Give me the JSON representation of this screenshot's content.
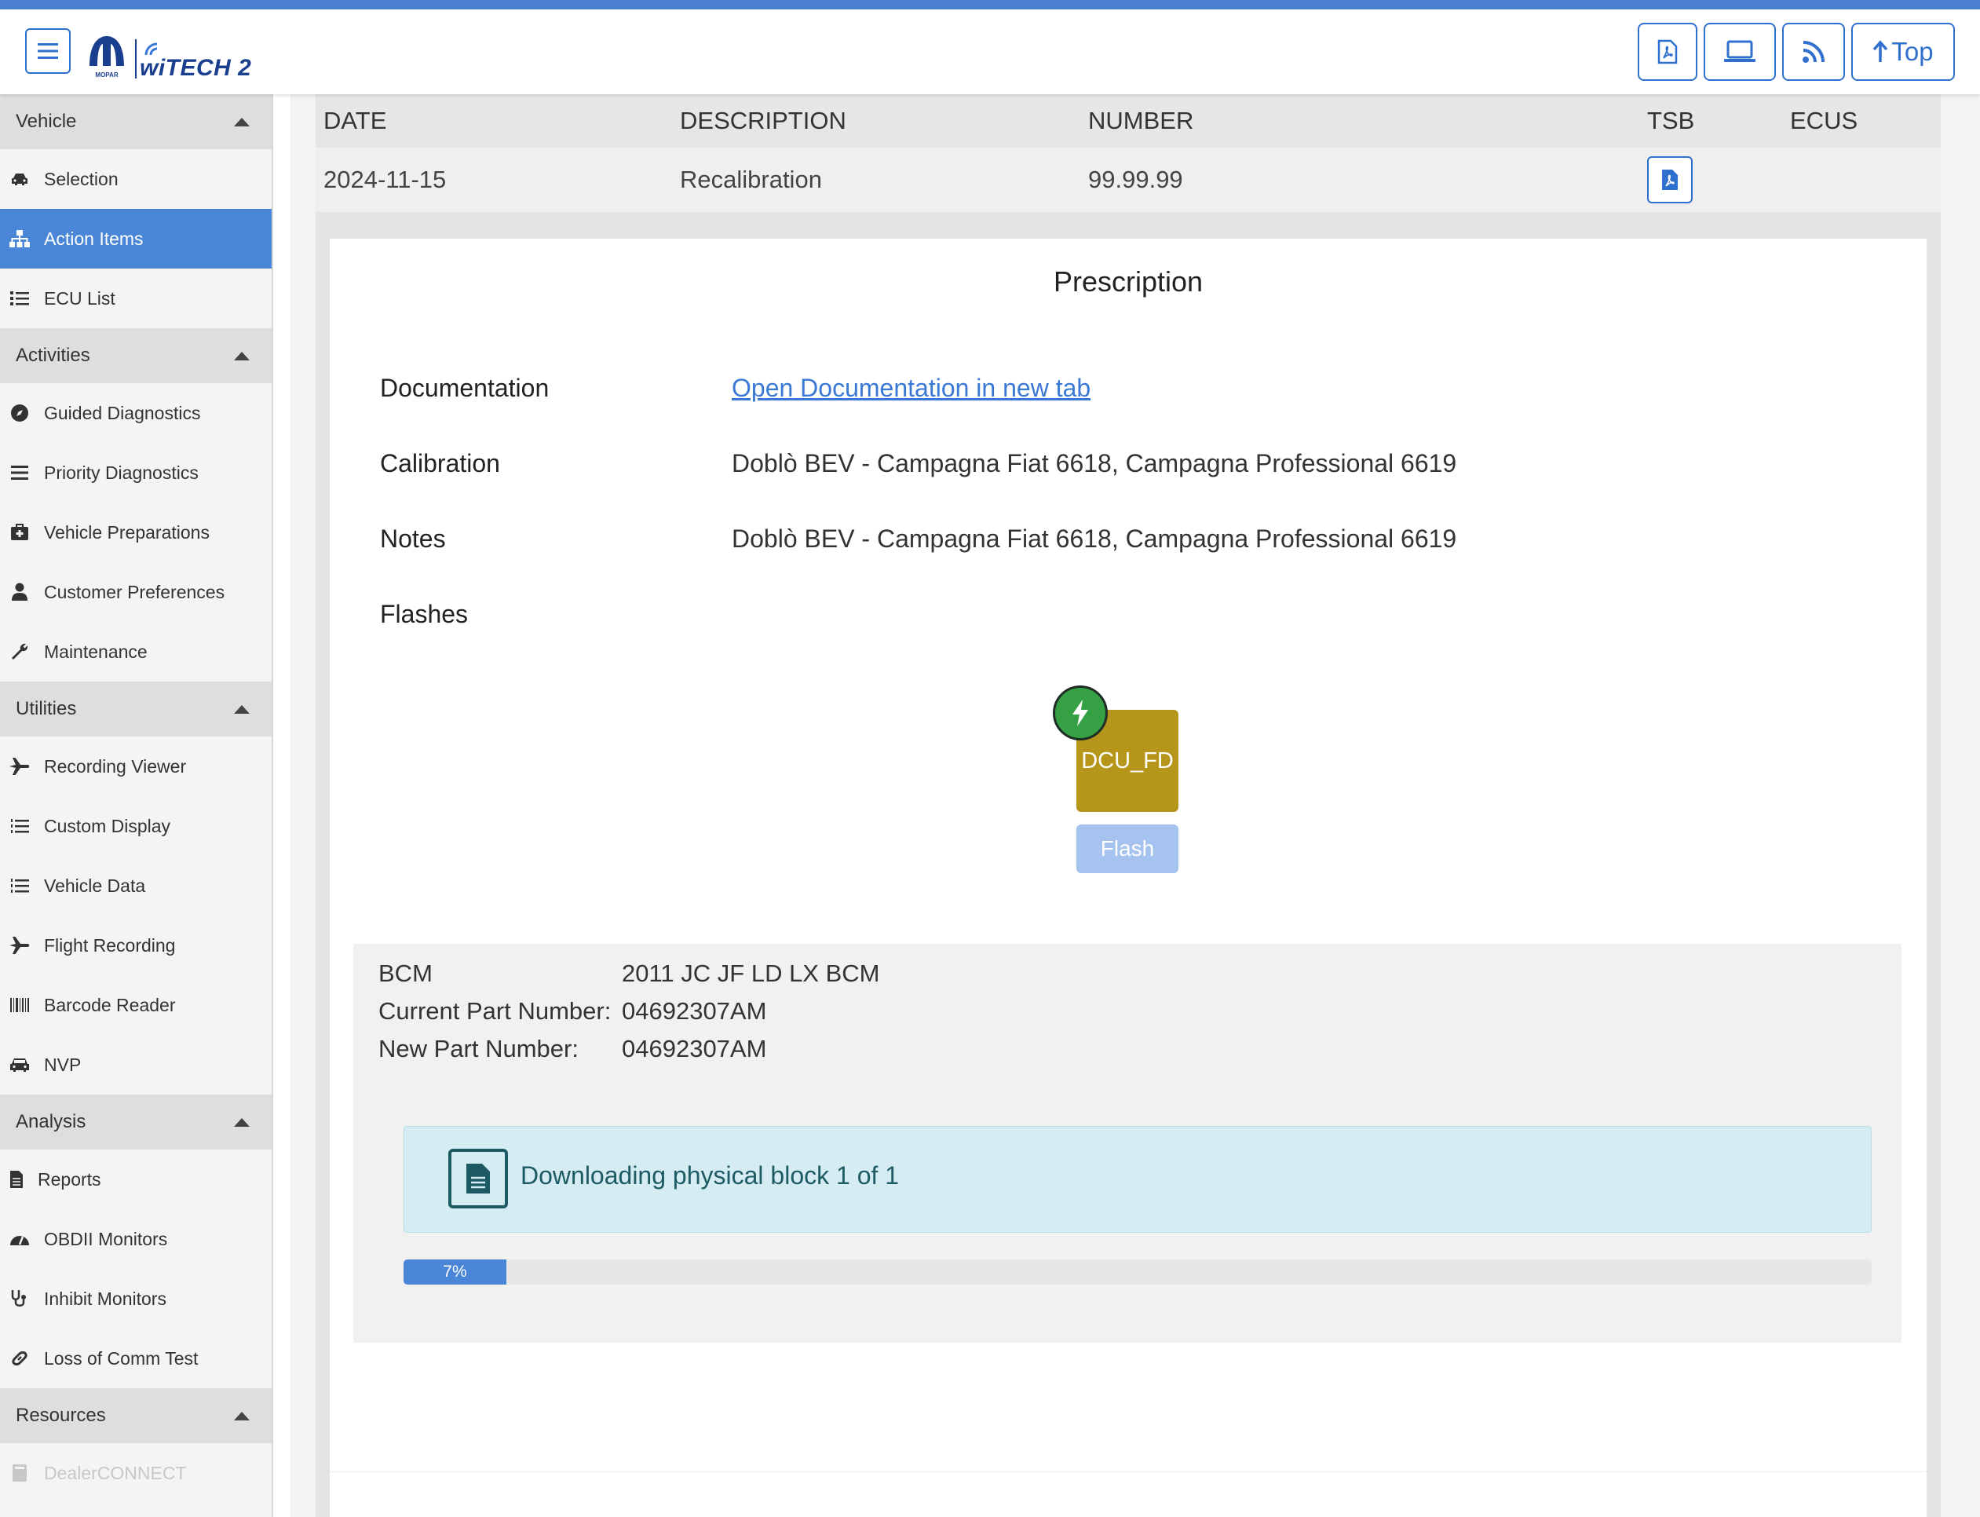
{
  "header": {
    "brand_mopar": "MOPAR",
    "brand_witech": "wiTECH 2",
    "top_button_label": "Top",
    "icons": [
      "menu-icon",
      "pdf-icon",
      "laptop-icon",
      "rss-icon",
      "arrow-up-icon"
    ]
  },
  "sidebar": {
    "sections": [
      {
        "title": "Vehicle",
        "items": [
          {
            "label": "Selection",
            "icon": "car-icon"
          },
          {
            "label": "Action Items",
            "icon": "sitemap-icon",
            "active": true
          },
          {
            "label": "ECU List",
            "icon": "list-icon"
          }
        ]
      },
      {
        "title": "Activities",
        "items": [
          {
            "label": "Guided Diagnostics",
            "icon": "compass-icon"
          },
          {
            "label": "Priority Diagnostics",
            "icon": "priority-icon"
          },
          {
            "label": "Vehicle Preparations",
            "icon": "medkit-icon"
          },
          {
            "label": "Customer Preferences",
            "icon": "user-icon"
          },
          {
            "label": "Maintenance",
            "icon": "wrench-icon"
          }
        ]
      },
      {
        "title": "Utilities",
        "items": [
          {
            "label": "Recording Viewer",
            "icon": "plane-icon"
          },
          {
            "label": "Custom Display",
            "icon": "list-ol-icon"
          },
          {
            "label": "Vehicle Data",
            "icon": "list-ol-icon"
          },
          {
            "label": "Flight Recording",
            "icon": "plane-icon"
          },
          {
            "label": "Barcode Reader",
            "icon": "barcode-icon"
          },
          {
            "label": "NVP",
            "icon": "car-front-icon"
          }
        ]
      },
      {
        "title": "Analysis",
        "items": [
          {
            "label": "Reports",
            "icon": "file-icon"
          },
          {
            "label": "OBDII Monitors",
            "icon": "gauge-icon"
          },
          {
            "label": "Inhibit Monitors",
            "icon": "stethoscope-icon"
          },
          {
            "label": "Loss of Comm Test",
            "icon": "link-icon"
          }
        ]
      },
      {
        "title": "Resources",
        "items": [
          {
            "label": "DealerCONNECT",
            "icon": "book-icon",
            "disabled": true
          }
        ]
      }
    ]
  },
  "table": {
    "headers": {
      "date": "DATE",
      "description": "DESCRIPTION",
      "number": "NUMBER",
      "tsb": "TSB",
      "ecus": "ECUS"
    },
    "row": {
      "date": "2024-11-15",
      "description": "Recalibration",
      "number": "99.99.99"
    }
  },
  "prescription": {
    "title": "Prescription",
    "documentation_label": "Documentation",
    "documentation_link": "Open Documentation in new tab",
    "calibration_label": "Calibration",
    "calibration_value": "Doblò BEV - Campagna Fiat 6618, Campagna Professional 6619",
    "notes_label": "Notes",
    "notes_value": "Doblò BEV - Campagna Fiat 6618, Campagna Professional 6619",
    "flashes_label": "Flashes",
    "ecu_name": "DCU_FD",
    "flash_button": "Flash"
  },
  "flash_details": {
    "module_label": "BCM",
    "module_value": "2011 JC JF LD LX BCM",
    "current_part_label": "Current Part Number:",
    "current_part_value": "04692307AM",
    "new_part_label": "New Part Number:",
    "new_part_value": "04692307AM",
    "status_message": "Downloading physical block 1 of 1",
    "progress_percent": 7,
    "progress_label": "7%"
  },
  "colors": {
    "accent": "#4a86d8",
    "ecu_tile": "#b5951a",
    "flash_badge": "#36a044",
    "alert_bg": "#d4ecf2"
  }
}
